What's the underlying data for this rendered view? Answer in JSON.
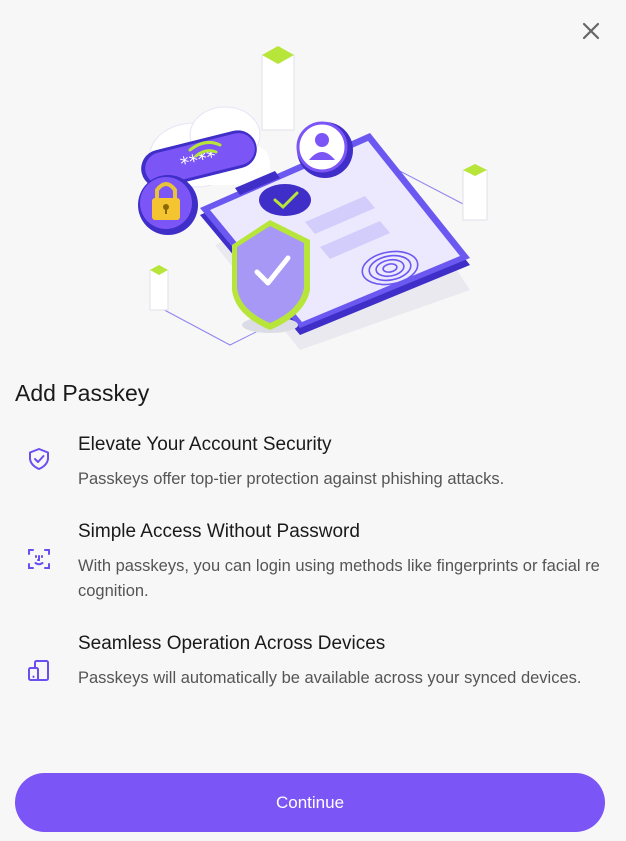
{
  "dialog": {
    "title": "Add Passkey",
    "close_icon": "close-icon"
  },
  "hero": {
    "password_mask": "****",
    "illustration": "passkey-security-illustration"
  },
  "features": [
    {
      "icon": "shield-check-icon",
      "heading": "Elevate Your Account Security",
      "description": "Passkeys offer top-tier protection against phishing attacks."
    },
    {
      "icon": "face-scan-icon",
      "heading": "Simple Access Without Password",
      "description": "With passkeys, you can login using methods like fingerprints or facial recognition."
    },
    {
      "icon": "devices-icon",
      "heading": "Seamless Operation Across Devices",
      "description": "Passkeys will automatically be available across your synced devices."
    }
  ],
  "actions": {
    "continue_label": "Continue"
  },
  "colors": {
    "accent": "#7b55f6",
    "accent_dark": "#3f2ec8",
    "lime": "#b7e53a",
    "background": "#f7f7f7"
  }
}
